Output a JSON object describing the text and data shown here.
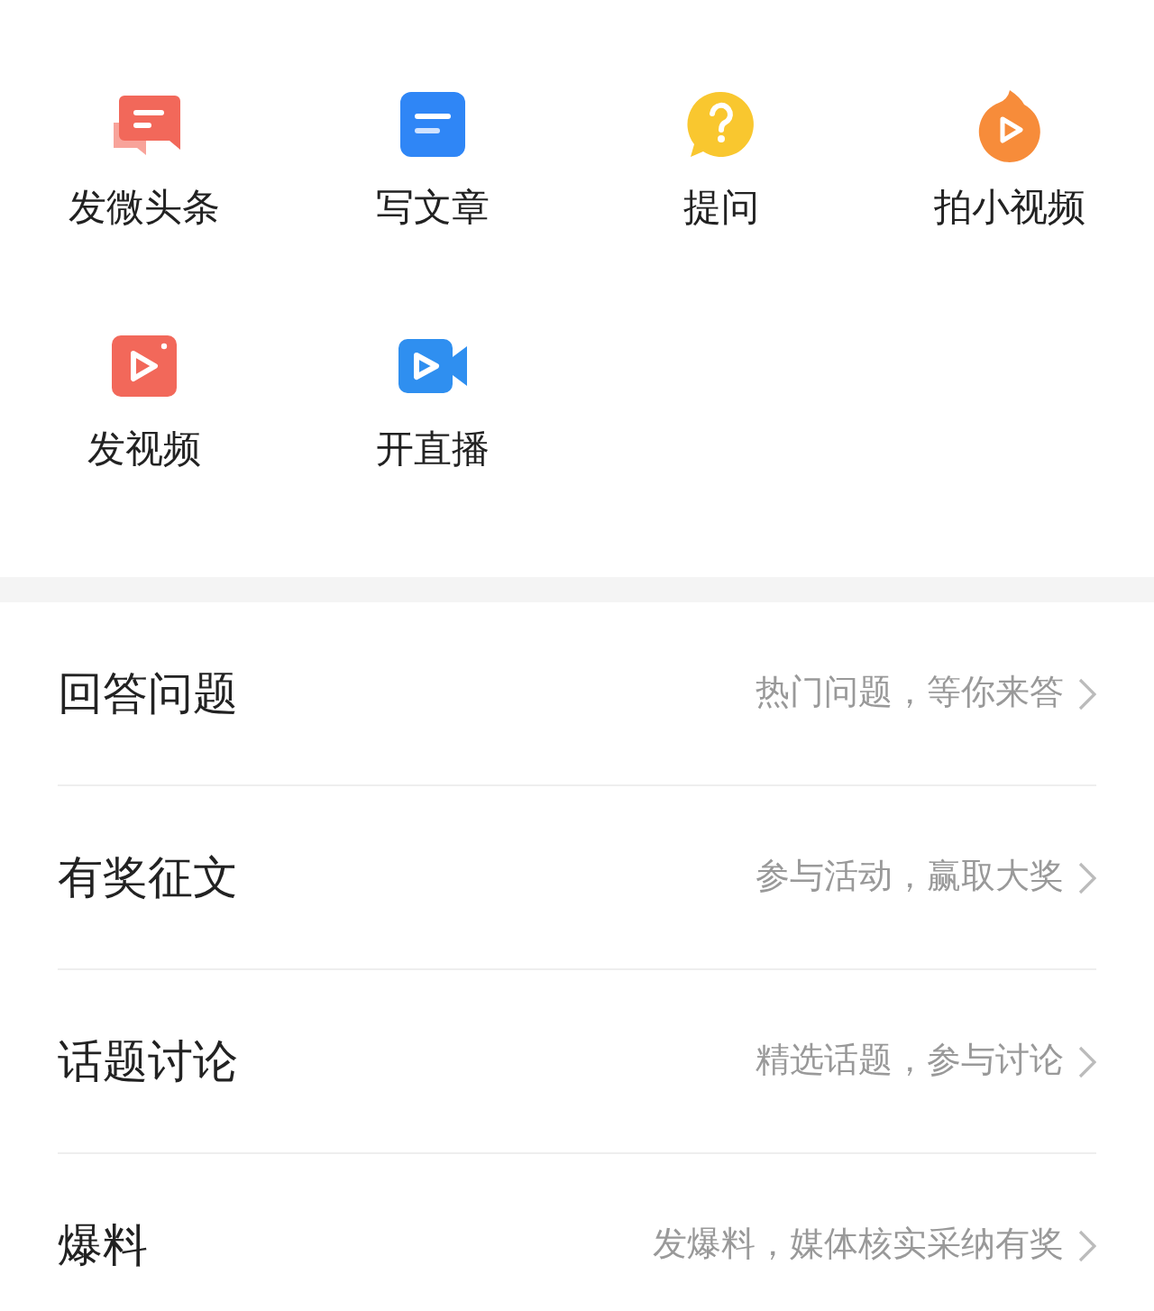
{
  "actions": [
    {
      "label": "发微头条"
    },
    {
      "label": "写文章"
    },
    {
      "label": "提问"
    },
    {
      "label": "拍小视频"
    },
    {
      "label": "发视频"
    },
    {
      "label": "开直播"
    }
  ],
  "entries": [
    {
      "title": "回答问题",
      "subtitle": "热门问题，等你来答"
    },
    {
      "title": "有奖征文",
      "subtitle": "参与活动，赢取大奖"
    },
    {
      "title": "话题讨论",
      "subtitle": "精选话题，参与讨论"
    },
    {
      "title": "爆料",
      "subtitle": "发爆料，媒体核实采纳有奖"
    }
  ]
}
